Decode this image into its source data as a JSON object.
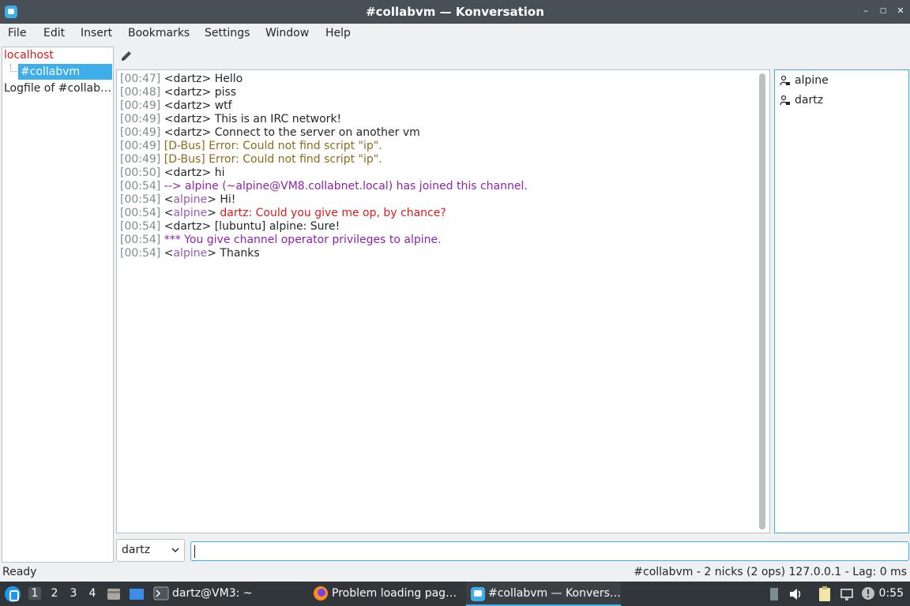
{
  "window": {
    "title": "#collabvm — Konversation",
    "minimize": "–",
    "maximize": "▢",
    "close": "✕"
  },
  "menu": [
    "File",
    "Edit",
    "Insert",
    "Bookmarks",
    "Settings",
    "Window",
    "Help"
  ],
  "tree": {
    "server": "localhost",
    "channel": "#collabvm",
    "logfile": "Logfile of #collabvm"
  },
  "chat": {
    "lines": [
      {
        "ts": "[00:47]",
        "nick": "<dartz>",
        "text": " Hello",
        "kind": "normal"
      },
      {
        "ts": "[00:48]",
        "nick": "<dartz>",
        "text": " piss",
        "kind": "normal"
      },
      {
        "ts": "[00:49]",
        "nick": "<dartz>",
        "text": " wtf",
        "kind": "normal"
      },
      {
        "ts": "[00:49]",
        "nick": "<dartz>",
        "text": " This is an IRC network!",
        "kind": "normal"
      },
      {
        "ts": "[00:49]",
        "nick": "<dartz>",
        "text": " Connect to the server on another vm",
        "kind": "normal"
      },
      {
        "ts": "[00:49]",
        "nick": "[D-Bus]",
        "text": " Error: Could not find script \"ip\".",
        "kind": "error"
      },
      {
        "ts": "[00:49]",
        "nick": "[D-Bus]",
        "text": " Error: Could not find script \"ip\".",
        "kind": "error"
      },
      {
        "ts": "[00:50]",
        "nick": "<dartz>",
        "text": " hi",
        "kind": "normal"
      },
      {
        "ts": "[00:54]",
        "nick": "",
        "text": "--> alpine (~alpine@VM8.collabnet.local) has joined this channel.",
        "kind": "join"
      },
      {
        "ts": "[00:54]",
        "nick": "alpine",
        "text": " Hi!",
        "kind": "alpine"
      },
      {
        "ts": "[00:54]",
        "nick": "alpine",
        "text": " dartz: Could you give me op, by chance?",
        "kind": "alpine-hl"
      },
      {
        "ts": "[00:54]",
        "nick": "<dartz>",
        "text": " [lubuntu] alpine: Sure!",
        "kind": "normal"
      },
      {
        "ts": "[00:54]",
        "nick": "",
        "text": "*** You give channel operator privileges to alpine.",
        "kind": "op"
      },
      {
        "ts": "[00:54]",
        "nick": "alpine",
        "text": " Thanks",
        "kind": "alpine"
      }
    ]
  },
  "nicklist": [
    "alpine",
    "dartz"
  ],
  "input": {
    "nick": "dartz",
    "value": ""
  },
  "status": {
    "left": "Ready",
    "right": "#collabvm - 2 nicks (2 ops)  127.0.0.1 - Lag: 0 ms"
  },
  "taskbar": {
    "workspaces": [
      "1",
      "2",
      "3",
      "4"
    ],
    "tasks": [
      "dartz@VM3: ~",
      "Problem loading pag…",
      "#collabvm — Konvers…"
    ],
    "clock": "0:55"
  }
}
